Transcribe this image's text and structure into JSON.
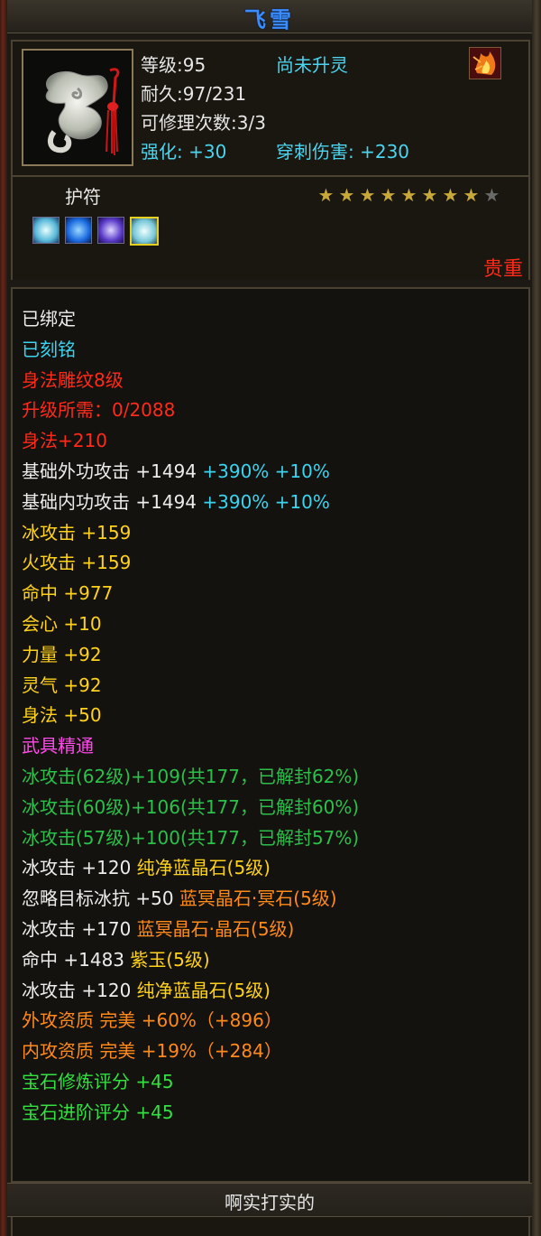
{
  "title": "飞雪",
  "item": {
    "level": "等级:95",
    "spirit_status": "尚未升灵",
    "durability": "耐久:97/231",
    "repairs": "可修理次数:3/3",
    "enhance": "强化: +30",
    "pierce": "穿刺伤害: +230",
    "icon_name": "jade-pendant-icon",
    "corner_icon_name": "flame-icon"
  },
  "amulet": {
    "label": "护符",
    "stars_filled": 8,
    "stars_total": 9,
    "gems": [
      "white-crystal-icon",
      "blue-crystal-icon",
      "purple-crystal-icon",
      "white-crystal-icon"
    ],
    "precious": "贵重"
  },
  "lines": [
    {
      "segments": [
        {
          "text": "已绑定",
          "color": "w"
        }
      ]
    },
    {
      "segments": [
        {
          "text": "已刻铭",
          "color": "c"
        }
      ]
    },
    {
      "segments": [
        {
          "text": "身法雕纹8级",
          "color": "r"
        }
      ]
    },
    {
      "segments": [
        {
          "text": "升级所需：0/2088",
          "color": "r"
        }
      ]
    },
    {
      "segments": [
        {
          "text": "身法+210",
          "color": "r"
        }
      ]
    },
    {
      "segments": [
        {
          "text": "基础外功攻击 +1494 ",
          "color": "w"
        },
        {
          "text": "+390% +10%",
          "color": "c"
        }
      ]
    },
    {
      "segments": [
        {
          "text": "基础内功攻击 +1494 ",
          "color": "w"
        },
        {
          "text": "+390% +10%",
          "color": "c"
        }
      ]
    },
    {
      "segments": [
        {
          "text": "冰攻击 +159",
          "color": "y"
        }
      ]
    },
    {
      "segments": [
        {
          "text": "火攻击 +159",
          "color": "y"
        }
      ]
    },
    {
      "segments": [
        {
          "text": "命中 +977",
          "color": "y"
        }
      ]
    },
    {
      "segments": [
        {
          "text": "会心 +10",
          "color": "y"
        }
      ]
    },
    {
      "segments": [
        {
          "text": "力量 +92",
          "color": "y"
        }
      ]
    },
    {
      "segments": [
        {
          "text": "灵气 +92",
          "color": "y"
        }
      ]
    },
    {
      "segments": [
        {
          "text": "身法 +50",
          "color": "y"
        }
      ]
    },
    {
      "segments": [
        {
          "text": "武具精通",
          "color": "p"
        }
      ]
    },
    {
      "segments": [
        {
          "text": "冰攻击(62级)+109(共177，已解封62%)",
          "color": "g"
        }
      ]
    },
    {
      "segments": [
        {
          "text": "冰攻击(60级)+106(共177，已解封60%)",
          "color": "g"
        }
      ]
    },
    {
      "segments": [
        {
          "text": "冰攻击(57级)+100(共177，已解封57%)",
          "color": "g"
        }
      ]
    },
    {
      "segments": [
        {
          "text": "冰攻击 +120 ",
          "color": "w"
        },
        {
          "text": "纯净蓝晶石(5级)",
          "color": "y"
        }
      ]
    },
    {
      "segments": [
        {
          "text": "忽略目标冰抗 +50 ",
          "color": "w"
        },
        {
          "text": "蓝冥晶石·冥石(5级)",
          "color": "o"
        }
      ]
    },
    {
      "segments": [
        {
          "text": "冰攻击 +170 ",
          "color": "w"
        },
        {
          "text": "蓝冥晶石·晶石(5级)",
          "color": "o"
        }
      ]
    },
    {
      "segments": [
        {
          "text": "命中 +1483 ",
          "color": "w"
        },
        {
          "text": "紫玉(5级)",
          "color": "y"
        }
      ]
    },
    {
      "segments": [
        {
          "text": "冰攻击 +120 ",
          "color": "w"
        },
        {
          "text": "纯净蓝晶石(5级)",
          "color": "y"
        }
      ]
    },
    {
      "segments": [
        {
          "text": "外攻资质  完美 +60%（+896）",
          "color": "o"
        }
      ]
    },
    {
      "segments": [
        {
          "text": "内攻资质  完美 +19%（+284）",
          "color": "o"
        }
      ]
    },
    {
      "segments": [
        {
          "text": "宝石修炼评分 +45",
          "color": "lg"
        }
      ]
    },
    {
      "segments": [
        {
          "text": "宝石进阶评分 +45",
          "color": "lg"
        }
      ]
    }
  ],
  "footer": "啊实打实的",
  "colors": {
    "title": "#3a8cff",
    "white": "#ececec",
    "cyan": "#3ad4f0",
    "red": "#ff2a1a",
    "yellow": "#ffd21a",
    "pink": "#ff4aea",
    "green": "#2ac04a",
    "orange": "#ff8a1a",
    "bright_green": "#32e040"
  }
}
